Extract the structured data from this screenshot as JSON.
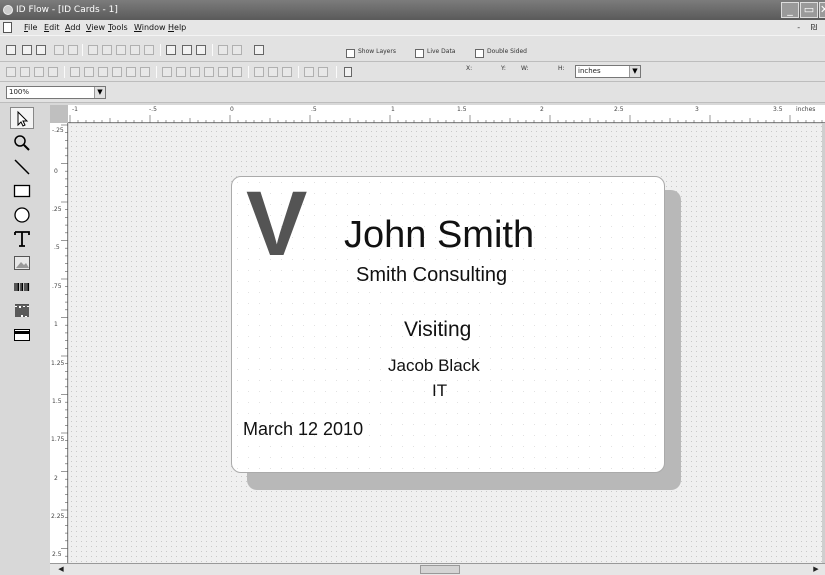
{
  "window": {
    "title": "ID Flow - [ID Cards - 1]",
    "minimize": "_",
    "maximize": "▭",
    "close": "✕"
  },
  "menu": {
    "items": [
      "File",
      "Edit",
      "Add",
      "View",
      "Tools",
      "Window",
      "Help"
    ],
    "mdi_controls": "- ₪"
  },
  "toolbar1": {
    "show_layers": {
      "label": "Show Layers",
      "checked": false
    },
    "live_data": {
      "label": "Live Data",
      "checked": false
    },
    "double_sided": {
      "label": "Double Sided",
      "checked": false
    }
  },
  "toolbar2": {
    "x_label": "X:",
    "y_label": "Y:",
    "w_label": "W:",
    "h_label": "H:",
    "units": "inches"
  },
  "toolbar3": {
    "zoom": "100%"
  },
  "ruler": {
    "top_labels": [
      "-1",
      "-.5",
      "0",
      ".5",
      "1",
      "1.5",
      "2",
      "2.5",
      "3",
      "3.5",
      "inches"
    ],
    "left_labels": [
      "-.25",
      "0",
      ".25",
      ".5",
      ".75",
      "1",
      "1.25",
      "1.5",
      "1.75",
      "2",
      "2.25",
      "2.5"
    ]
  },
  "card": {
    "logo_letter": "V",
    "name": "John Smith",
    "company": "Smith Consulting",
    "status": "Visiting",
    "host": "Jacob Black",
    "department": "IT",
    "date": "March 12 2010"
  }
}
